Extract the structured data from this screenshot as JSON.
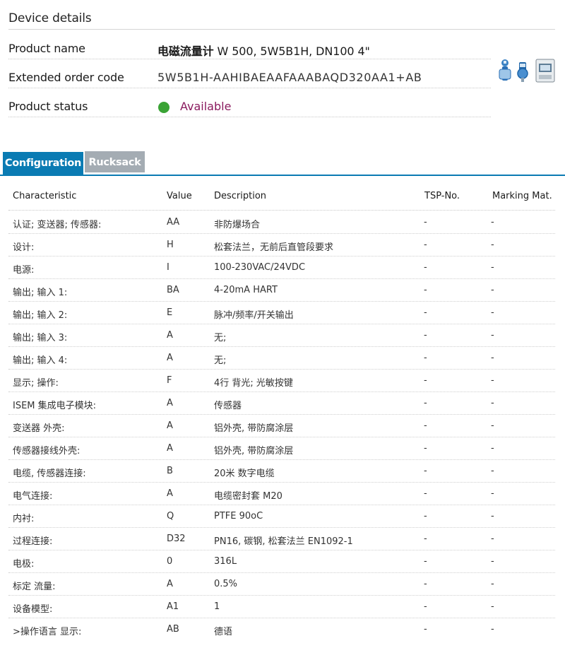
{
  "section": {
    "title": "Device details"
  },
  "details": {
    "product_name_label": "Product name",
    "product_name_bold": "电磁流量计",
    "product_name_rest": " W 500, 5W5B1H, DN100 4\"",
    "order_code_label": "Extended order code",
    "order_code_value": "5W5B1H-AAHIBAEAAFAAABAQD320AA1+AB",
    "status_label": "Product status",
    "status_value": "Available",
    "status_color": "#3aa335"
  },
  "tabs": [
    {
      "label": "Configuration",
      "active": true
    },
    {
      "label": "Rucksack",
      "active": false
    }
  ],
  "table": {
    "headers": [
      "Characteristic",
      "Value",
      "Description",
      "TSP-No.",
      "Marking Mat."
    ],
    "rows": [
      {
        "characteristic": "认证; 变送器; 传感器:",
        "value": "AA",
        "description": "非防爆场合",
        "tsp": "-",
        "marking": "-"
      },
      {
        "characteristic": "设计:",
        "value": "H",
        "description": "松套法兰，无前后直管段要求",
        "tsp": "-",
        "marking": "-"
      },
      {
        "characteristic": "电源:",
        "value": "I",
        "description": "100-230VAC/24VDC",
        "tsp": "-",
        "marking": "-"
      },
      {
        "characteristic": "输出; 输入 1:",
        "value": "BA",
        "description": "4-20mA HART",
        "tsp": "-",
        "marking": "-"
      },
      {
        "characteristic": "输出; 输入 2:",
        "value": "E",
        "description": "脉冲/频率/开关输出",
        "tsp": "-",
        "marking": "-"
      },
      {
        "characteristic": "输出; 输入 3:",
        "value": "A",
        "description": "无;",
        "tsp": "-",
        "marking": "-"
      },
      {
        "characteristic": "输出; 输入 4:",
        "value": "A",
        "description": "无;",
        "tsp": "-",
        "marking": "-"
      },
      {
        "characteristic": "显示; 操作:",
        "value": "F",
        "description": "4行 背光; 光敏按键",
        "tsp": "-",
        "marking": "-"
      },
      {
        "characteristic": "ISEM 集成电子模块:",
        "value": "A",
        "description": "传感器",
        "tsp": "-",
        "marking": "-"
      },
      {
        "characteristic": "变送器 外壳:",
        "value": "A",
        "description": "铝外壳, 带防腐涂层",
        "tsp": "-",
        "marking": "-"
      },
      {
        "characteristic": "传感器接线外壳:",
        "value": "A",
        "description": "铝外壳, 带防腐涂层",
        "tsp": "-",
        "marking": "-"
      },
      {
        "characteristic": "电缆, 传感器连接:",
        "value": "B",
        "description": "20米 数字电缆",
        "tsp": "-",
        "marking": "-"
      },
      {
        "characteristic": "电气连接:",
        "value": "A",
        "description": "电缆密封套 M20",
        "tsp": "-",
        "marking": "-"
      },
      {
        "characteristic": "内衬:",
        "value": "Q",
        "description": "PTFE 90oC",
        "tsp": "-",
        "marking": "-"
      },
      {
        "characteristic": "过程连接:",
        "value": "D32",
        "description": "PN16, 碳钢, 松套法兰 EN1092-1",
        "tsp": "-",
        "marking": "-"
      },
      {
        "characteristic": "电极:",
        "value": "0",
        "description": "316L",
        "tsp": "-",
        "marking": "-"
      },
      {
        "characteristic": "标定 流量:",
        "value": "A",
        "description": "0.5%",
        "tsp": "-",
        "marking": "-"
      },
      {
        "characteristic": "设备模型:",
        "value": "A1",
        "description": "1",
        "tsp": "-",
        "marking": "-"
      },
      {
        "characteristic": ">操作语言 显示:",
        "value": "AB",
        "description": "德语",
        "tsp": "-",
        "marking": "-"
      }
    ]
  },
  "colors": {
    "accent": "#0a7bb3",
    "inactive_tab": "#a4acb3",
    "status_text": "#8a1a5e"
  }
}
